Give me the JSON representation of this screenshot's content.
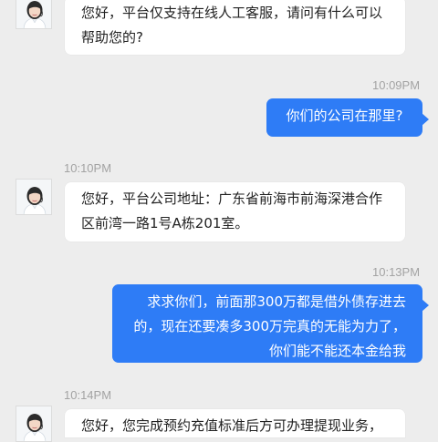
{
  "messages": [
    {
      "side": "in",
      "lines": [
        "您好，平台仅支持在线人工客服，请问有什么可以",
        "帮助您的?"
      ]
    },
    {
      "timestamp": "10:09PM",
      "side": "out",
      "text": "你们的公司在那里?"
    },
    {
      "timestamp": "10:10PM",
      "side": "in",
      "lines": [
        "您好，平台公司地址：广东省前海市前海深港合作",
        "区前湾一路1号A栋201室。"
      ]
    },
    {
      "timestamp": "10:13PM",
      "side": "out",
      "lines": [
        "求求你们，前面那300万都是借外债存进去",
        "的，现在还要凑多300万完真的无能为力了，",
        "你们能不能还本金给我"
      ]
    },
    {
      "timestamp": "10:14PM",
      "side": "in",
      "lines": [
        "您好，您完成预约充值标准后方可办理提现业务，"
      ]
    }
  ],
  "colors": {
    "background": "#ededed",
    "sent_bubble": "#2e7cf6",
    "received_bubble": "#ffffff",
    "timestamp": "#a3a3a3"
  },
  "icons": {
    "agent_avatar": "customer-service-agent-avatar-icon"
  }
}
